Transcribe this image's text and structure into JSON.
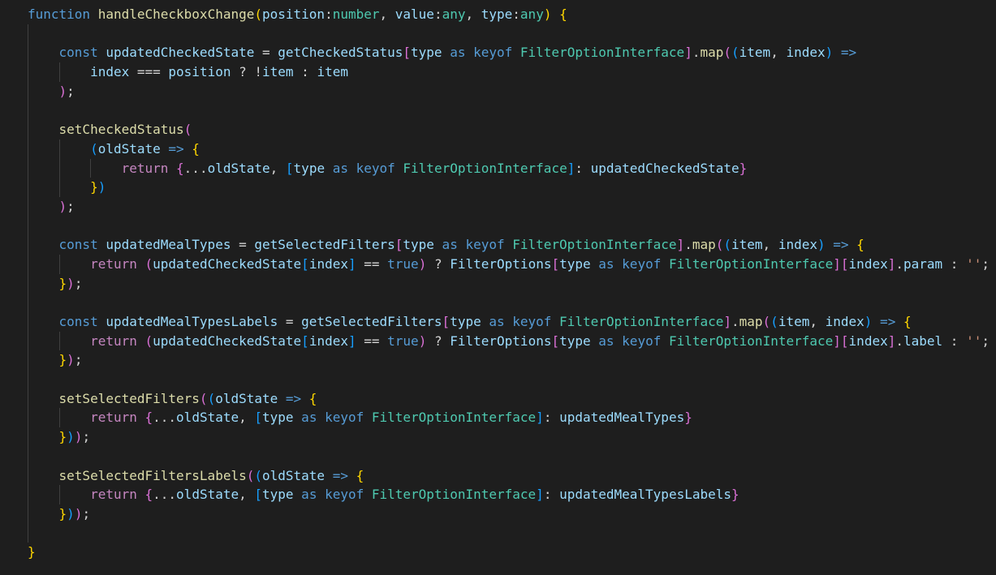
{
  "editor": {
    "language": "typescript",
    "theme": "vs-dark",
    "indent_columns": 4,
    "lines": [
      {
        "indent": 0,
        "tokens": [
          [
            "function ",
            "kw"
          ],
          [
            "handleCheckboxChange",
            "fn"
          ],
          [
            "(",
            "b1"
          ],
          [
            "position",
            "var"
          ],
          [
            ":",
            "op"
          ],
          [
            "number",
            "type"
          ],
          [
            ", ",
            "op"
          ],
          [
            "value",
            "var"
          ],
          [
            ":",
            "op"
          ],
          [
            "any",
            "type"
          ],
          [
            ", ",
            "op"
          ],
          [
            "type",
            "var"
          ],
          [
            ":",
            "op"
          ],
          [
            "any",
            "type"
          ],
          [
            ")",
            "b1"
          ],
          [
            " ",
            "op"
          ],
          [
            "{",
            "b1"
          ]
        ]
      },
      {
        "indent": 0,
        "tokens": []
      },
      {
        "indent": 1,
        "tokens": [
          [
            "const ",
            "kw"
          ],
          [
            "updatedCheckedState",
            "var"
          ],
          [
            " = ",
            "op"
          ],
          [
            "getCheckedStatus",
            "var"
          ],
          [
            "[",
            "b2"
          ],
          [
            "type",
            "var"
          ],
          [
            " as ",
            "kw"
          ],
          [
            "keyof ",
            "kw"
          ],
          [
            "FilterOptionInterface",
            "type"
          ],
          [
            "]",
            "b2"
          ],
          [
            ".",
            "op"
          ],
          [
            "map",
            "fn"
          ],
          [
            "(",
            "b2"
          ],
          [
            "(",
            "b3"
          ],
          [
            "item",
            "var"
          ],
          [
            ", ",
            "op"
          ],
          [
            "index",
            "var"
          ],
          [
            ")",
            "b3"
          ],
          [
            " =>",
            "kw"
          ]
        ]
      },
      {
        "indent": 2,
        "tokens": [
          [
            "index",
            "var"
          ],
          [
            " === ",
            "op"
          ],
          [
            "position",
            "var"
          ],
          [
            " ? !",
            "op"
          ],
          [
            "item",
            "var"
          ],
          [
            " : ",
            "op"
          ],
          [
            "item",
            "var"
          ]
        ]
      },
      {
        "indent": 1,
        "tokens": [
          [
            ")",
            "b2"
          ],
          [
            ";",
            "op"
          ]
        ]
      },
      {
        "indent": 0,
        "tokens": []
      },
      {
        "indent": 1,
        "tokens": [
          [
            "setCheckedStatus",
            "fn"
          ],
          [
            "(",
            "b2"
          ]
        ]
      },
      {
        "indent": 2,
        "tokens": [
          [
            "(",
            "b3"
          ],
          [
            "oldState",
            "var"
          ],
          [
            " => ",
            "kw"
          ],
          [
            "{",
            "b1"
          ]
        ]
      },
      {
        "indent": 3,
        "tokens": [
          [
            "return ",
            "ctrl"
          ],
          [
            "{",
            "b2"
          ],
          [
            "...",
            "op"
          ],
          [
            "oldState",
            "var"
          ],
          [
            ", ",
            "op"
          ],
          [
            "[",
            "b3"
          ],
          [
            "type",
            "var"
          ],
          [
            " as ",
            "kw"
          ],
          [
            "keyof ",
            "kw"
          ],
          [
            "FilterOptionInterface",
            "type"
          ],
          [
            "]",
            "b3"
          ],
          [
            ": ",
            "op"
          ],
          [
            "updatedCheckedState",
            "var"
          ],
          [
            "}",
            "b2"
          ]
        ]
      },
      {
        "indent": 2,
        "tokens": [
          [
            "}",
            "b1"
          ],
          [
            ")",
            "b3"
          ]
        ]
      },
      {
        "indent": 1,
        "tokens": [
          [
            ")",
            "b2"
          ],
          [
            ";",
            "op"
          ]
        ]
      },
      {
        "indent": 0,
        "tokens": []
      },
      {
        "indent": 1,
        "tokens": [
          [
            "const ",
            "kw"
          ],
          [
            "updatedMealTypes",
            "var"
          ],
          [
            " = ",
            "op"
          ],
          [
            "getSelectedFilters",
            "var"
          ],
          [
            "[",
            "b2"
          ],
          [
            "type",
            "var"
          ],
          [
            " as ",
            "kw"
          ],
          [
            "keyof ",
            "kw"
          ],
          [
            "FilterOptionInterface",
            "type"
          ],
          [
            "]",
            "b2"
          ],
          [
            ".",
            "op"
          ],
          [
            "map",
            "fn"
          ],
          [
            "(",
            "b2"
          ],
          [
            "(",
            "b3"
          ],
          [
            "item",
            "var"
          ],
          [
            ", ",
            "op"
          ],
          [
            "index",
            "var"
          ],
          [
            ")",
            "b3"
          ],
          [
            " => ",
            "kw"
          ],
          [
            "{",
            "b1"
          ]
        ]
      },
      {
        "indent": 2,
        "tokens": [
          [
            "return ",
            "ctrl"
          ],
          [
            "(",
            "b2"
          ],
          [
            "updatedCheckedState",
            "var"
          ],
          [
            "[",
            "b3"
          ],
          [
            "index",
            "var"
          ],
          [
            "]",
            "b3"
          ],
          [
            " == ",
            "op"
          ],
          [
            "true",
            "kw"
          ],
          [
            ")",
            "b2"
          ],
          [
            " ? ",
            "op"
          ],
          [
            "FilterOptions",
            "var"
          ],
          [
            "[",
            "b2"
          ],
          [
            "type",
            "var"
          ],
          [
            " as ",
            "kw"
          ],
          [
            "keyof ",
            "kw"
          ],
          [
            "FilterOptionInterface",
            "type"
          ],
          [
            "]",
            "b2"
          ],
          [
            "[",
            "b2"
          ],
          [
            "index",
            "var"
          ],
          [
            "]",
            "b2"
          ],
          [
            ".",
            "op"
          ],
          [
            "param",
            "var"
          ],
          [
            " : ",
            "op"
          ],
          [
            "''",
            "str"
          ],
          [
            ";",
            "op"
          ]
        ]
      },
      {
        "indent": 1,
        "tokens": [
          [
            "}",
            "b1"
          ],
          [
            ")",
            "b2"
          ],
          [
            ";",
            "op"
          ]
        ]
      },
      {
        "indent": 0,
        "tokens": []
      },
      {
        "indent": 1,
        "tokens": [
          [
            "const ",
            "kw"
          ],
          [
            "updatedMealTypesLabels",
            "var"
          ],
          [
            " = ",
            "op"
          ],
          [
            "getSelectedFilters",
            "var"
          ],
          [
            "[",
            "b2"
          ],
          [
            "type",
            "var"
          ],
          [
            " as ",
            "kw"
          ],
          [
            "keyof ",
            "kw"
          ],
          [
            "FilterOptionInterface",
            "type"
          ],
          [
            "]",
            "b2"
          ],
          [
            ".",
            "op"
          ],
          [
            "map",
            "fn"
          ],
          [
            "(",
            "b2"
          ],
          [
            "(",
            "b3"
          ],
          [
            "item",
            "var"
          ],
          [
            ", ",
            "op"
          ],
          [
            "index",
            "var"
          ],
          [
            ")",
            "b3"
          ],
          [
            " => ",
            "kw"
          ],
          [
            "{",
            "b1"
          ]
        ]
      },
      {
        "indent": 2,
        "tokens": [
          [
            "return ",
            "ctrl"
          ],
          [
            "(",
            "b2"
          ],
          [
            "updatedCheckedState",
            "var"
          ],
          [
            "[",
            "b3"
          ],
          [
            "index",
            "var"
          ],
          [
            "]",
            "b3"
          ],
          [
            " == ",
            "op"
          ],
          [
            "true",
            "kw"
          ],
          [
            ")",
            "b2"
          ],
          [
            " ? ",
            "op"
          ],
          [
            "FilterOptions",
            "var"
          ],
          [
            "[",
            "b2"
          ],
          [
            "type",
            "var"
          ],
          [
            " as ",
            "kw"
          ],
          [
            "keyof ",
            "kw"
          ],
          [
            "FilterOptionInterface",
            "type"
          ],
          [
            "]",
            "b2"
          ],
          [
            "[",
            "b2"
          ],
          [
            "index",
            "var"
          ],
          [
            "]",
            "b2"
          ],
          [
            ".",
            "op"
          ],
          [
            "label",
            "var"
          ],
          [
            " : ",
            "op"
          ],
          [
            "''",
            "str"
          ],
          [
            ";",
            "op"
          ]
        ]
      },
      {
        "indent": 1,
        "tokens": [
          [
            "}",
            "b1"
          ],
          [
            ")",
            "b2"
          ],
          [
            ";",
            "op"
          ]
        ]
      },
      {
        "indent": 0,
        "tokens": []
      },
      {
        "indent": 1,
        "tokens": [
          [
            "setSelectedFilters",
            "fn"
          ],
          [
            "(",
            "b2"
          ],
          [
            "(",
            "b3"
          ],
          [
            "oldState",
            "var"
          ],
          [
            " => ",
            "kw"
          ],
          [
            "{",
            "b1"
          ]
        ]
      },
      {
        "indent": 2,
        "tokens": [
          [
            "return ",
            "ctrl"
          ],
          [
            "{",
            "b2"
          ],
          [
            "...",
            "op"
          ],
          [
            "oldState",
            "var"
          ],
          [
            ", ",
            "op"
          ],
          [
            "[",
            "b3"
          ],
          [
            "type",
            "var"
          ],
          [
            " as ",
            "kw"
          ],
          [
            "keyof ",
            "kw"
          ],
          [
            "FilterOptionInterface",
            "type"
          ],
          [
            "]",
            "b3"
          ],
          [
            ": ",
            "op"
          ],
          [
            "updatedMealTypes",
            "var"
          ],
          [
            "}",
            "b2"
          ]
        ]
      },
      {
        "indent": 1,
        "tokens": [
          [
            "}",
            "b1"
          ],
          [
            ")",
            "b3"
          ],
          [
            ")",
            "b2"
          ],
          [
            ";",
            "op"
          ]
        ]
      },
      {
        "indent": 0,
        "tokens": []
      },
      {
        "indent": 1,
        "tokens": [
          [
            "setSelectedFiltersLabels",
            "fn"
          ],
          [
            "(",
            "b2"
          ],
          [
            "(",
            "b3"
          ],
          [
            "oldState",
            "var"
          ],
          [
            " => ",
            "kw"
          ],
          [
            "{",
            "b1"
          ]
        ]
      },
      {
        "indent": 2,
        "tokens": [
          [
            "return ",
            "ctrl"
          ],
          [
            "{",
            "b2"
          ],
          [
            "...",
            "op"
          ],
          [
            "oldState",
            "var"
          ],
          [
            ", ",
            "op"
          ],
          [
            "[",
            "b3"
          ],
          [
            "type",
            "var"
          ],
          [
            " as ",
            "kw"
          ],
          [
            "keyof ",
            "kw"
          ],
          [
            "FilterOptionInterface",
            "type"
          ],
          [
            "]",
            "b3"
          ],
          [
            ": ",
            "op"
          ],
          [
            "updatedMealTypesLabels",
            "var"
          ],
          [
            "}",
            "b2"
          ]
        ]
      },
      {
        "indent": 1,
        "tokens": [
          [
            "}",
            "b1"
          ],
          [
            ")",
            "b3"
          ],
          [
            ")",
            "b2"
          ],
          [
            ";",
            "op"
          ]
        ]
      },
      {
        "indent": 0,
        "tokens": []
      },
      {
        "indent": 0,
        "tokens": [
          [
            "}",
            "b1"
          ]
        ]
      }
    ]
  },
  "colors": {
    "background": "#1e1e1e",
    "keyword": "#569cd6",
    "control": "#c586c0",
    "function": "#dcdcaa",
    "variable": "#9cdcfe",
    "type": "#4ec9b0",
    "string": "#ce9178",
    "bracket_level_1": "#ffd700",
    "bracket_level_2": "#da70d6",
    "bracket_level_3": "#179fff",
    "indent_guide": "#404040"
  }
}
